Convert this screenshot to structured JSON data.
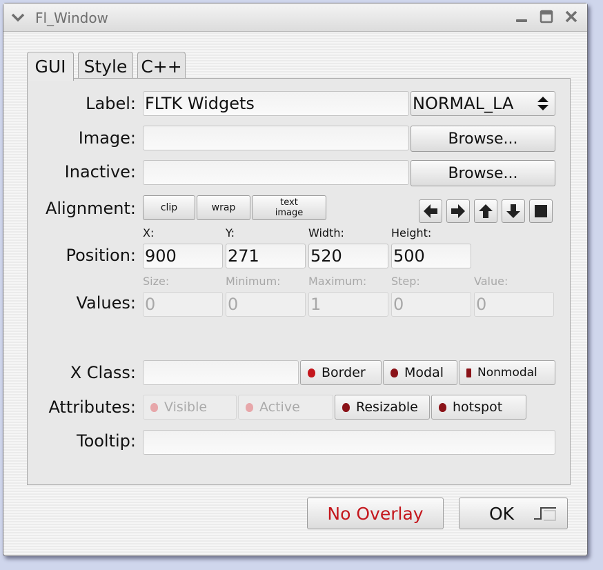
{
  "window": {
    "title": "Fl_Window"
  },
  "tabs": [
    {
      "label": "GUI"
    },
    {
      "label": "Style"
    },
    {
      "label": "C++"
    }
  ],
  "gui": {
    "label": {
      "caption": "Label:",
      "value": "FLTK Widgets",
      "type": "NORMAL_LA"
    },
    "image": {
      "caption": "Image:",
      "value": "",
      "browse": "Browse..."
    },
    "inactive": {
      "caption": "Inactive:",
      "value": "",
      "browse": "Browse..."
    },
    "alignment": {
      "caption": "Alignment:",
      "clip": "clip",
      "wrap": "wrap",
      "text_image_1": "text",
      "text_image_2": "image",
      "arrows": [
        "left-arrow-icon",
        "right-arrow-icon",
        "up-arrow-icon",
        "down-arrow-icon",
        "square-icon"
      ]
    },
    "position": {
      "caption": "Position:",
      "x_label": "X:",
      "y_label": "Y:",
      "w_label": "Width:",
      "h_label": "Height:",
      "x": "900",
      "y": "271",
      "w": "520",
      "h": "500"
    },
    "values": {
      "caption": "Values:",
      "size_label": "Size:",
      "min_label": "Minimum:",
      "max_label": "Maximum:",
      "step_label": "Step:",
      "value_label": "Value:",
      "size": "0",
      "min": "0",
      "max": "1",
      "step": "0",
      "value": "0"
    },
    "xclass": {
      "caption": "X Class:",
      "value": "",
      "border": "Border",
      "modal": "Modal",
      "nonmodal": "Nonmodal"
    },
    "attributes": {
      "caption": "Attributes:",
      "visible": "Visible",
      "active": "Active",
      "resizable": "Resizable",
      "hotspot": "hotspot"
    },
    "tooltip": {
      "caption": "Tooltip:",
      "value": ""
    }
  },
  "footer": {
    "overlay": "No Overlay",
    "ok": "OK"
  },
  "colors": {
    "overlay_text": "#c4161c",
    "check_on": "#a0141c",
    "check_off": "#e7a7aa"
  }
}
